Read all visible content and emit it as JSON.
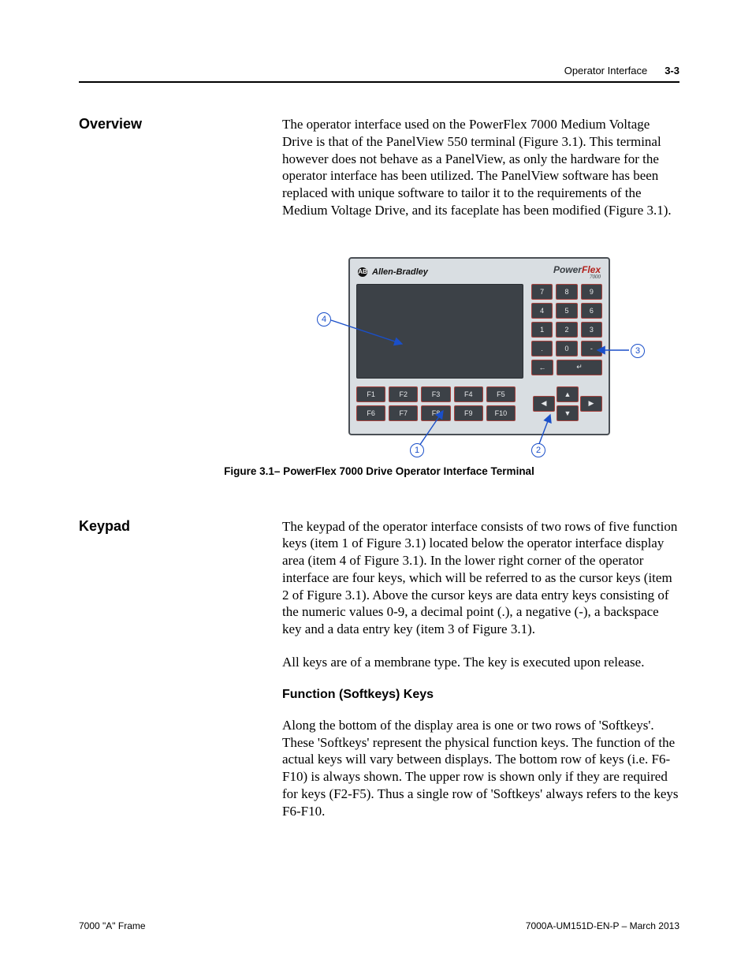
{
  "header": {
    "section": "Operator Interface",
    "page": "3-3"
  },
  "overview": {
    "heading": "Overview",
    "para": "The operator interface used on the PowerFlex 7000 Medium Voltage Drive is that of the PanelView 550 terminal (Figure 3.1).  This terminal however does not behave as a PanelView, as only the hardware for the operator interface has been utilized.  The PanelView software has been replaced with unique software to tailor it to the requirements of the Medium Voltage Drive, and its faceplate has been modified (Figure 3.1)."
  },
  "figure": {
    "caption": "Figure 3.1– PowerFlex 7000 Drive Operator Interface Terminal",
    "brand_left": "Allen-Bradley",
    "brand_right_a": "Power",
    "brand_right_b": "Flex",
    "brand_sub": "7000",
    "numpad": [
      [
        "7",
        "8",
        "9"
      ],
      [
        "4",
        "5",
        "6"
      ],
      [
        "1",
        "2",
        "3"
      ],
      [
        ".",
        "0",
        "-"
      ]
    ],
    "back": "←",
    "enter": "↵",
    "fkeys_top": [
      "F1",
      "F2",
      "F3",
      "F4",
      "F5"
    ],
    "fkeys_bot": [
      "F6",
      "F7",
      "F8",
      "F9",
      "F10"
    ],
    "dpad": {
      "up": "▲",
      "down": "▼",
      "left": "◀",
      "right": "▶"
    },
    "callouts": {
      "c1": "1",
      "c2": "2",
      "c3": "3",
      "c4": "4"
    }
  },
  "keypad": {
    "heading": "Keypad",
    "para1": "The keypad of the operator interface consists of two rows of five function keys (item 1 of Figure 3.1) located below the operator interface display area (item 4 of Figure 3.1).  In the lower right corner of the operator interface are four keys, which will be referred to as the cursor keys (item 2 of Figure 3.1).  Above the cursor keys are data entry keys consisting of the numeric values 0-9, a decimal point (.), a negative (-), a backspace key and a data entry key (item 3 of Figure 3.1).",
    "para2": "All keys are of a membrane type.  The key is executed upon release.",
    "subhead": "Function (Softkeys) Keys",
    "para3": "Along the bottom of the display area is one or two rows of 'Softkeys'. These 'Softkeys' represent the physical function keys.  The function of the actual keys will vary between displays.  The bottom row of keys (i.e. F6-F10) is always shown.  The upper row is shown only if they are required for keys (F2-F5).  Thus a single row of 'Softkeys' always refers to the keys F6-F10."
  },
  "footer": {
    "left": "7000 \"A\" Frame",
    "right": "7000A-UM151D-EN-P – March 2013"
  }
}
